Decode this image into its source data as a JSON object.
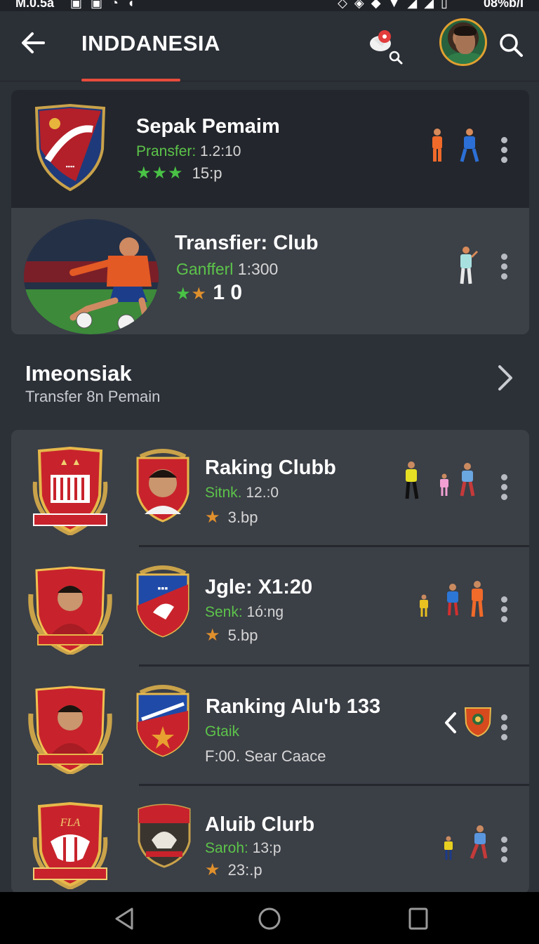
{
  "status_bar": {
    "time": "M.0.5a",
    "battery": "08%b/I"
  },
  "app_bar": {
    "title": "INDDANESIA"
  },
  "featured": [
    {
      "title": "Sepak Pemaim",
      "sub_label": "Pransfer:",
      "sub_value": "1.2:10",
      "stars": 3,
      "star_color": "#49c246",
      "rating_text": "15:p"
    },
    {
      "title": "Transfier: Club",
      "sub_label": "Ganfferl",
      "sub_value": "1:300",
      "stars_green": 1,
      "stars_orange": 1,
      "rating_text": "1 0"
    }
  ],
  "section": {
    "title": "Imeonsiak",
    "subtitle": "Transfer 8n Pemain"
  },
  "list": [
    {
      "title": "Raking Clubb",
      "sub_label": "Sitnk.",
      "sub_value": "12.:0",
      "rating_text": "3.bp"
    },
    {
      "title": "Jgle:  X1:20",
      "sub_label": "Senk:",
      "sub_value": "1ó:ng",
      "rating_text": "5.bp"
    },
    {
      "title": "Ranking Alu'b 133",
      "sub_label": "Gtaik",
      "sub_value": "",
      "rating_text": "F:00. Sear Caace"
    },
    {
      "title": "Aluib Clurb",
      "sub_label": "Saroh:",
      "sub_value": "13:p",
      "rating_text": "23:.p"
    }
  ],
  "colors": {
    "accent": "#e84c3d",
    "green": "#5cc44a",
    "star_orange": "#e0902c",
    "background": "#2c3037",
    "card": "#3b3f46"
  },
  "icons": {
    "back": "arrow-left-icon",
    "whistle": "whistle-search-icon",
    "search": "search-icon",
    "more": "more-vert-icon",
    "chevron": "chevron-right-icon"
  }
}
